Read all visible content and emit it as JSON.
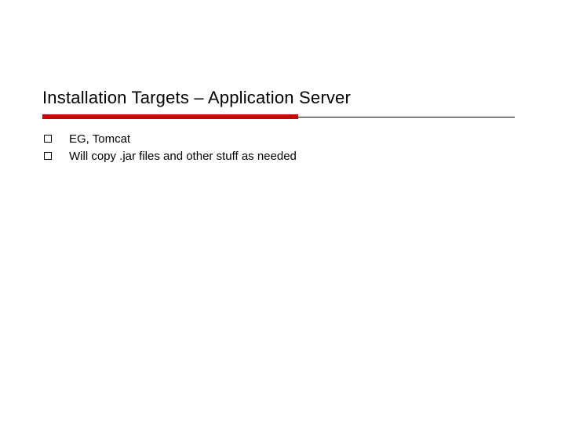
{
  "title": "Installation Targets – Application Server",
  "bullets": {
    "b0": "EG, Tomcat",
    "b1": "Will copy .jar files and other stuff as needed"
  },
  "colors": {
    "accent": "#cc0000"
  }
}
